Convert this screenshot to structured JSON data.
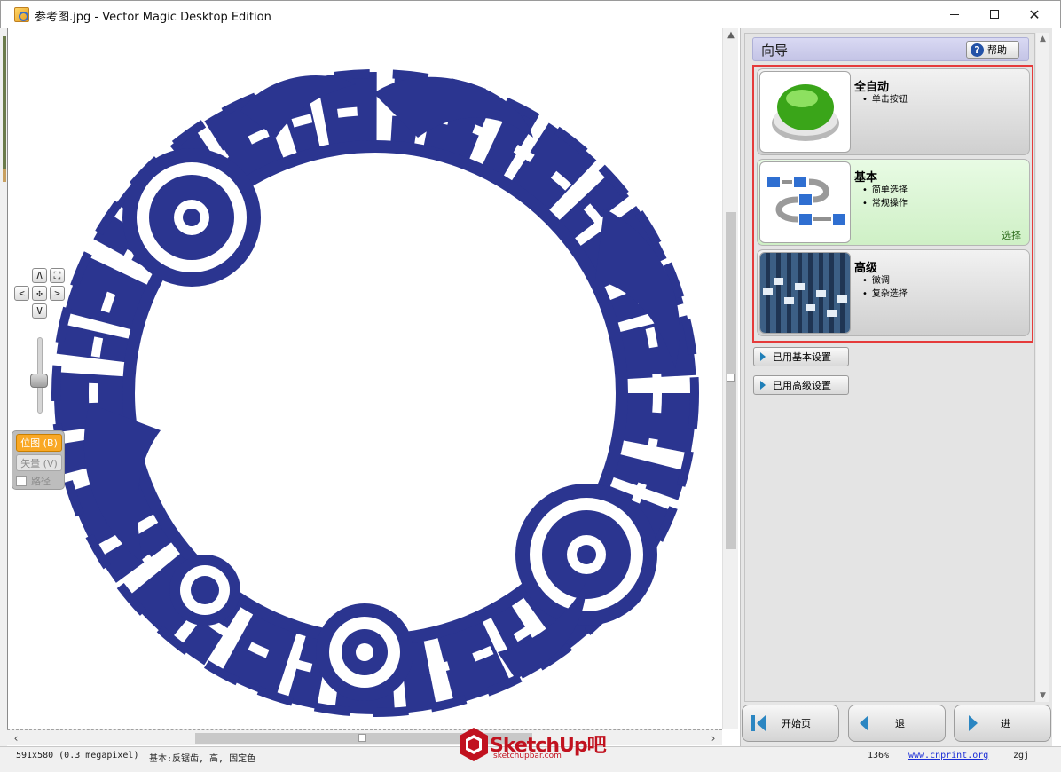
{
  "window": {
    "title": "参考图.jpg - Vector Magic Desktop Edition"
  },
  "canvas": {
    "nav": {
      "up": "Λ",
      "down": "V",
      "left": "<",
      "right": ">",
      "fit": "⛶",
      "center": "✣"
    },
    "modes": {
      "bitmap": "位图 (B)",
      "vector": "矢量 (V)",
      "path": "路径"
    }
  },
  "wizard": {
    "title": "向导",
    "help": "帮助",
    "options": [
      {
        "title": "全自动",
        "bullets": [
          "单击按钮"
        ]
      },
      {
        "title": "基本",
        "bullets": [
          "简单选择",
          "常规操作"
        ],
        "select_label": "选择"
      },
      {
        "title": "高级",
        "bullets": [
          "微调",
          "复杂选择"
        ]
      }
    ],
    "basic_settings": "已用基本设置",
    "advanced_settings": "已用高级设置"
  },
  "bottom_nav": {
    "start": "开始页",
    "back": "退",
    "next": "进"
  },
  "status": {
    "size": "591x580 (0.3 megapixel)",
    "mode": "基本:反锯齿, 高, 固定色",
    "zoom": "136%",
    "link": "www.cnprint.org",
    "user": "zgj"
  },
  "watermark": {
    "brand": "SketchUp吧",
    "url": "sketchupbar.com"
  },
  "colors": {
    "artwork_blue": "#2b3590",
    "highlight_red": "#e53b3b",
    "bitmap_orange": "#f9a825"
  }
}
